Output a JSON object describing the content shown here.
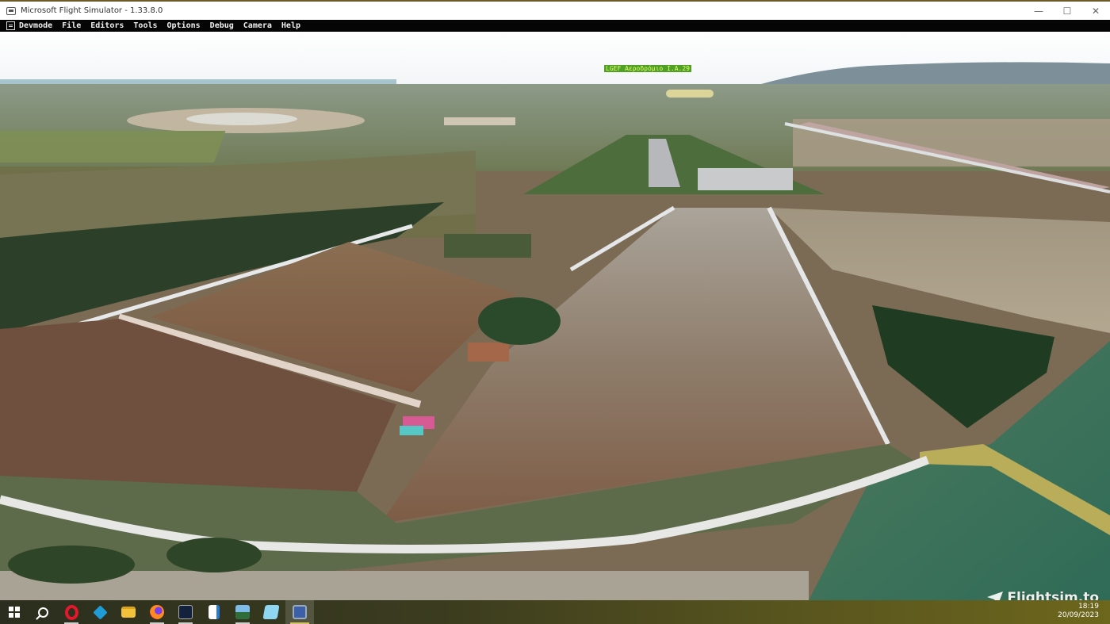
{
  "window": {
    "title": "Microsoft Flight Simulator - 1.33.8.0",
    "minimize": "—",
    "maximize": "☐",
    "close": "✕"
  },
  "devmode_menu": {
    "items": [
      "Devmode",
      "File",
      "Editors",
      "Tools",
      "Options",
      "Debug",
      "Camera",
      "Help"
    ]
  },
  "scene": {
    "airport_label": "LGEF Αεροδρόμιο Ι.Α.29",
    "description_icons": [
      "airstrip",
      "fields",
      "roads",
      "trees",
      "farmhouse",
      "pool"
    ]
  },
  "watermark": {
    "text": "Flightsim.to",
    "icon": "paper-plane-icon"
  },
  "taskbar": {
    "apps": [
      {
        "name": "start-button",
        "icon": "windows-start-icon"
      },
      {
        "name": "search-button",
        "icon": "search-icon"
      },
      {
        "name": "opera",
        "icon": "opera-icon"
      },
      {
        "name": "kodi",
        "icon": "kodi-icon"
      },
      {
        "name": "file-explorer",
        "icon": "folder-icon"
      },
      {
        "name": "firefox",
        "icon": "firefox-icon"
      },
      {
        "name": "app",
        "icon": "app-icon"
      },
      {
        "name": "document",
        "icon": "document-icon"
      },
      {
        "name": "photos",
        "icon": "photo-icon"
      },
      {
        "name": "notes",
        "icon": "notes-icon"
      },
      {
        "name": "save-app",
        "icon": "save-icon"
      }
    ],
    "time": "18:19",
    "date": "20/09/2023"
  }
}
